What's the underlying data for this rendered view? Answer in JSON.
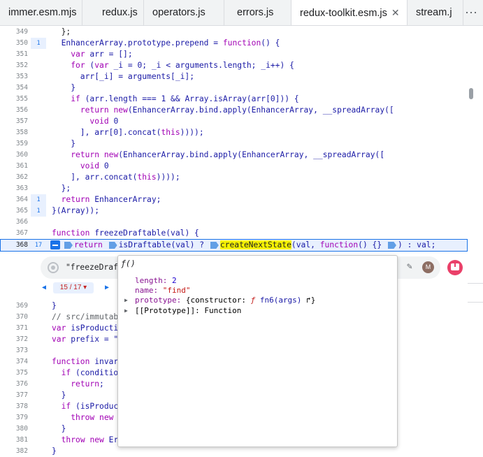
{
  "tabs": [
    {
      "label": "immer.esm.mjs",
      "active": false
    },
    {
      "label": "redux.js",
      "active": false
    },
    {
      "label": "operators.js",
      "active": false
    },
    {
      "label": "errors.js",
      "active": false
    },
    {
      "label": "redux-toolkit.esm.js",
      "active": true
    },
    {
      "label": "stream.j",
      "active": false
    }
  ],
  "tab_close_glyph": "✕",
  "tab_more_glyph": "⋯",
  "lines_top": [
    {
      "n": "349",
      "cnt": ""
    },
    {
      "n": "350",
      "cnt": "1"
    },
    {
      "n": "351",
      "cnt": ""
    },
    {
      "n": "352",
      "cnt": ""
    },
    {
      "n": "353",
      "cnt": ""
    },
    {
      "n": "354",
      "cnt": ""
    },
    {
      "n": "355",
      "cnt": ""
    },
    {
      "n": "356",
      "cnt": ""
    },
    {
      "n": "357",
      "cnt": ""
    },
    {
      "n": "358",
      "cnt": ""
    },
    {
      "n": "359",
      "cnt": ""
    },
    {
      "n": "360",
      "cnt": ""
    },
    {
      "n": "361",
      "cnt": ""
    },
    {
      "n": "362",
      "cnt": ""
    },
    {
      "n": "363",
      "cnt": ""
    },
    {
      "n": "364",
      "cnt": "1"
    },
    {
      "n": "365",
      "cnt": "1"
    },
    {
      "n": "366",
      "cnt": ""
    },
    {
      "n": "367",
      "cnt": ""
    },
    {
      "n": "368",
      "cnt": "17"
    }
  ],
  "lines_bottom": [
    {
      "n": "369"
    },
    {
      "n": "370"
    },
    {
      "n": "371"
    },
    {
      "n": "372"
    },
    {
      "n": "373"
    },
    {
      "n": "374"
    },
    {
      "n": "375"
    },
    {
      "n": "376"
    },
    {
      "n": "377"
    },
    {
      "n": "378"
    },
    {
      "n": "379"
    },
    {
      "n": "380"
    },
    {
      "n": "381"
    },
    {
      "n": "382"
    }
  ],
  "code": {
    "l349": "  };",
    "l350a": "  EnhancerArray.prototype.prepend = ",
    "l350b": "function",
    "l350c": "() {",
    "l351a": "    ",
    "l351b": "var",
    "l351c": " arr = [];",
    "l352a": "    ",
    "l352b": "for",
    "l352c": " (",
    "l352d": "var",
    "l352e": " _i = 0; _i < arguments.length; _i++) {",
    "l353": "      arr[_i] = arguments[_i];",
    "l354": "    }",
    "l355a": "    ",
    "l355b": "if",
    "l355c": " (arr.length === 1 && Array.isArray(arr[0])) {",
    "l356a": "      ",
    "l356b": "return",
    "l356c": " ",
    "l356d": "new",
    "l356e": "(EnhancerArray.bind.apply(EnhancerArray, __spreadArray([",
    "l357a": "        ",
    "l357b": "void",
    "l357c": " 0",
    "l358a": "      ], arr[0].concat(",
    "l358b": "this",
    "l358c": "))));",
    "l359": "    }",
    "l360a": "    ",
    "l360b": "return",
    "l360c": " ",
    "l360d": "new",
    "l360e": "(EnhancerArray.bind.apply(EnhancerArray, __spreadArray([",
    "l361a": "      ",
    "l361b": "void",
    "l361c": " 0",
    "l362a": "    ], arr.concat(",
    "l362b": "this",
    "l362c": "))));",
    "l363": "  };",
    "l364a": "  ",
    "l364b": "return",
    "l364c": " EnhancerArray;",
    "l365": "}(Array));",
    "l366": "",
    "l367a": "function",
    "l367b": " freezeDraftable(val) {",
    "l368_return": "return",
    "l368_isdraft": "isDraftable(val) ?",
    "l368_create": "createNextState",
    "l368_rest1": "(val, ",
    "l368_function": "function",
    "l368_rest2": "() {}",
    "l368_rest3": ") : val;",
    "l369": "}",
    "l370": "// src/immutabl",
    "l371a": "var",
    "l371b": " isProductio",
    "l372a": "var",
    "l372b": " prefix = \"I",
    "l373": "",
    "l374a": "function",
    "l374b": " invari",
    "l375a": "  ",
    "l375b": "if",
    "l375c": " (conditio",
    "l376a": "    ",
    "l376b": "return",
    "l376c": ";",
    "l377": "  }",
    "l378a": "  ",
    "l378b": "if",
    "l378c": " (isProduct",
    "l379a": "    ",
    "l379b": "throw",
    "l379c": " ",
    "l379d": "new",
    "l379e": " E",
    "l380": "  }",
    "l381a": "  ",
    "l381b": "throw",
    "l381c": " ",
    "l381d": "new",
    "l381e": " Er",
    "l382": "}"
  },
  "conditional": {
    "text": "\"freezeDraft",
    "avatar_letter": "M"
  },
  "pager": {
    "prev": "◀",
    "label": "15 / 17 ▾",
    "next": "▶"
  },
  "popup": {
    "header": "ƒ()",
    "length_key": "length",
    "length_value": "2",
    "name_key": "name",
    "name_value": "\"find\"",
    "proto_key": "prototype",
    "proto_open": "{constructor: ",
    "proto_f": "ƒ",
    "proto_fn": " fn6(args)",
    "proto_link": " ↱",
    "proto_close": "}",
    "proto2": "[[Prototype]]: Function"
  },
  "colors": {
    "keyword": "#a100b4",
    "highlight": "#f7f300",
    "accent": "#1a73e8"
  }
}
